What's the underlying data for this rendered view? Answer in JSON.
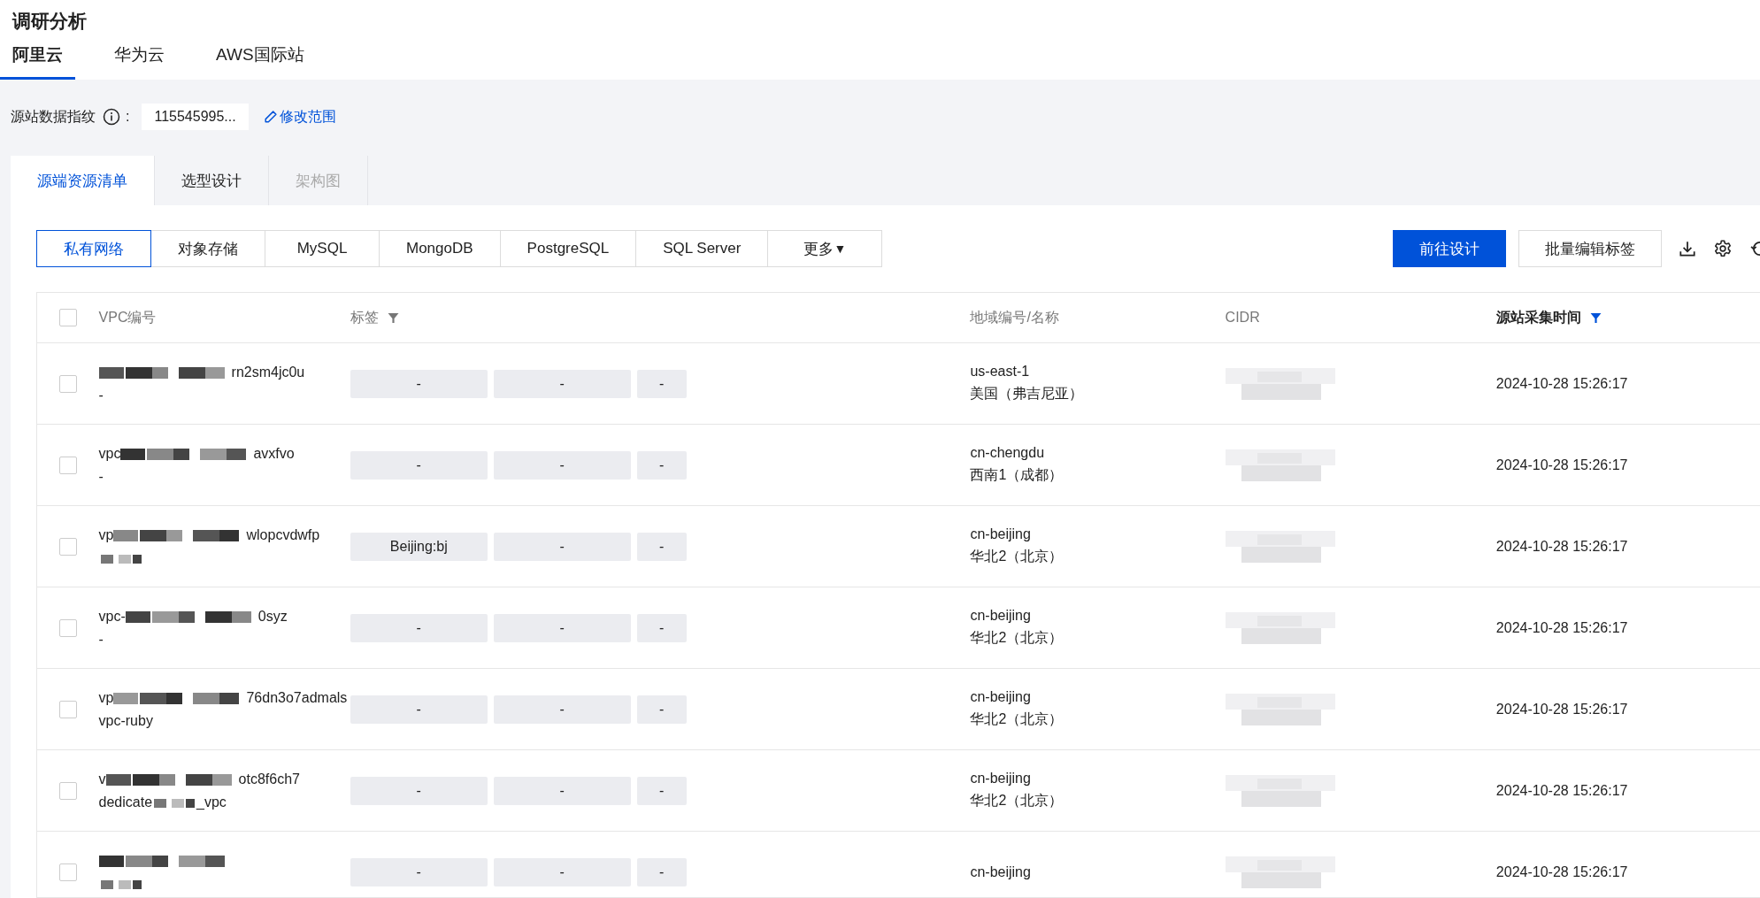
{
  "page_title": "调研分析",
  "cloud_tabs": [
    {
      "label": "阿里云",
      "selected": true
    },
    {
      "label": "华为云",
      "selected": false
    },
    {
      "label": "AWS国际站",
      "selected": false
    }
  ],
  "fingerprint": {
    "label": "源站数据指纹",
    "colon": ":",
    "value": "115545995...",
    "edit_link": "修改范围"
  },
  "view_tabs": [
    {
      "label": "源端资源清单",
      "selected": true,
      "disabled": false
    },
    {
      "label": "选型设计",
      "selected": false,
      "disabled": false
    },
    {
      "label": "架构图",
      "selected": false,
      "disabled": true
    }
  ],
  "resource_types": [
    {
      "label": "私有网络",
      "selected": true
    },
    {
      "label": "对象存储",
      "selected": false
    },
    {
      "label": "MySQL",
      "selected": false
    },
    {
      "label": "MongoDB",
      "selected": false
    },
    {
      "label": "PostgreSQL",
      "selected": false
    },
    {
      "label": "SQL Server",
      "selected": false
    },
    {
      "label": "更多",
      "selected": false,
      "caret": "▼"
    }
  ],
  "actions": {
    "primary": "前往设计",
    "secondary": "批量编辑标签"
  },
  "table": {
    "select_all_checked": false,
    "columns": [
      {
        "label": "VPC编号"
      },
      {
        "label": "标签",
        "filter_active": false
      },
      {
        "label": "地域编号/名称"
      },
      {
        "label": "CIDR"
      },
      {
        "label": "源站采集时间",
        "filter_active": true
      }
    ],
    "rows": [
      {
        "checked": false,
        "id_prefix": "",
        "id_suffix": "rn2sm4jc0u",
        "name": "-",
        "tags": [
          "-",
          "-",
          "-"
        ],
        "region_code": "us-east-1",
        "region_name": "美国（弗吉尼亚）",
        "time": "2024-10-28 15:26:17"
      },
      {
        "checked": false,
        "id_prefix": "vpc",
        "id_suffix": "avxfvo",
        "name": "-",
        "tags": [
          "-",
          "-",
          "-"
        ],
        "region_code": "cn-chengdu",
        "region_name": "西南1（成都）",
        "time": "2024-10-28 15:26:17"
      },
      {
        "checked": false,
        "id_prefix": "vp",
        "id_suffix": "wlopcvdwfp",
        "tags": [
          "Beijing:bj",
          "-",
          "-"
        ],
        "region_code": "cn-beijing",
        "region_name": "华北2（北京）",
        "time": "2024-10-28 15:26:17"
      },
      {
        "checked": false,
        "id_prefix": "vpc-",
        "id_suffix": "0syz",
        "name": "-",
        "tags": [
          "-",
          "-",
          "-"
        ],
        "region_code": "cn-beijing",
        "region_name": "华北2（北京）",
        "time": "2024-10-28 15:26:17"
      },
      {
        "checked": false,
        "id_prefix": "vp",
        "id_suffix": "76dn3o7admals",
        "name": "vpc-ruby",
        "tags": [
          "-",
          "-",
          "-"
        ],
        "region_code": "cn-beijing",
        "region_name": "华北2（北京）",
        "time": "2024-10-28 15:26:17"
      },
      {
        "checked": false,
        "id_prefix": "v",
        "id_suffix": "otc8f6ch7",
        "name": "dedicate",
        "name_suffix": "_vpc",
        "tags": [
          "-",
          "-",
          "-"
        ],
        "region_code": "cn-beijing",
        "region_name": "华北2（北京）",
        "time": "2024-10-28 15:26:17"
      },
      {
        "checked": false,
        "tags": [
          "-",
          "-",
          "-"
        ],
        "region_code": "cn-beijing",
        "time": "2024-10-28 15:26:17"
      }
    ]
  }
}
